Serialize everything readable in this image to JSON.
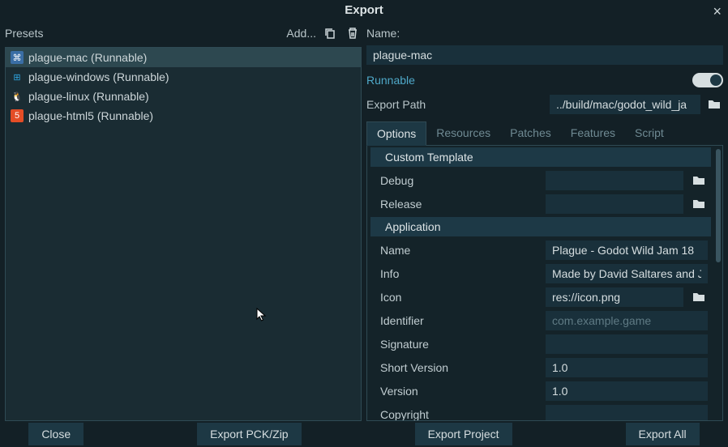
{
  "title": "Export",
  "presets_header": {
    "label": "Presets",
    "add_label": "Add..."
  },
  "presets": [
    {
      "label": "plague-mac (Runnable)",
      "platform": "mac"
    },
    {
      "label": "plague-windows (Runnable)",
      "platform": "windows"
    },
    {
      "label": "plague-linux (Runnable)",
      "platform": "linux"
    },
    {
      "label": "plague-html5 (Runnable)",
      "platform": "html5"
    }
  ],
  "name_label": "Name:",
  "name_value": "plague-mac",
  "runnable_label": "Runnable",
  "export_path_label": "Export Path",
  "export_path_value": "../build/mac/godot_wild_ja",
  "tabs": [
    {
      "label": "Options"
    },
    {
      "label": "Resources"
    },
    {
      "label": "Patches"
    },
    {
      "label": "Features"
    },
    {
      "label": "Script"
    }
  ],
  "sections": {
    "custom_template": "Custom Template",
    "application": "Application"
  },
  "props": {
    "debug_label": "Debug",
    "release_label": "Release",
    "app_name_label": "Name",
    "app_name_value": "Plague - Godot Wild Jam 18",
    "info_label": "Info",
    "info_value": "Made by David Saltares and J",
    "icon_label": "Icon",
    "icon_value": "res://icon.png",
    "identifier_label": "Identifier",
    "identifier_placeholder": "com.example.game",
    "signature_label": "Signature",
    "short_version_label": "Short Version",
    "short_version_value": "1.0",
    "version_label": "Version",
    "version_value": "1.0",
    "copyright_label": "Copyright"
  },
  "footer": {
    "close": "Close",
    "export_pck": "Export PCK/Zip",
    "export_project": "Export Project",
    "export_all": "Export All"
  }
}
